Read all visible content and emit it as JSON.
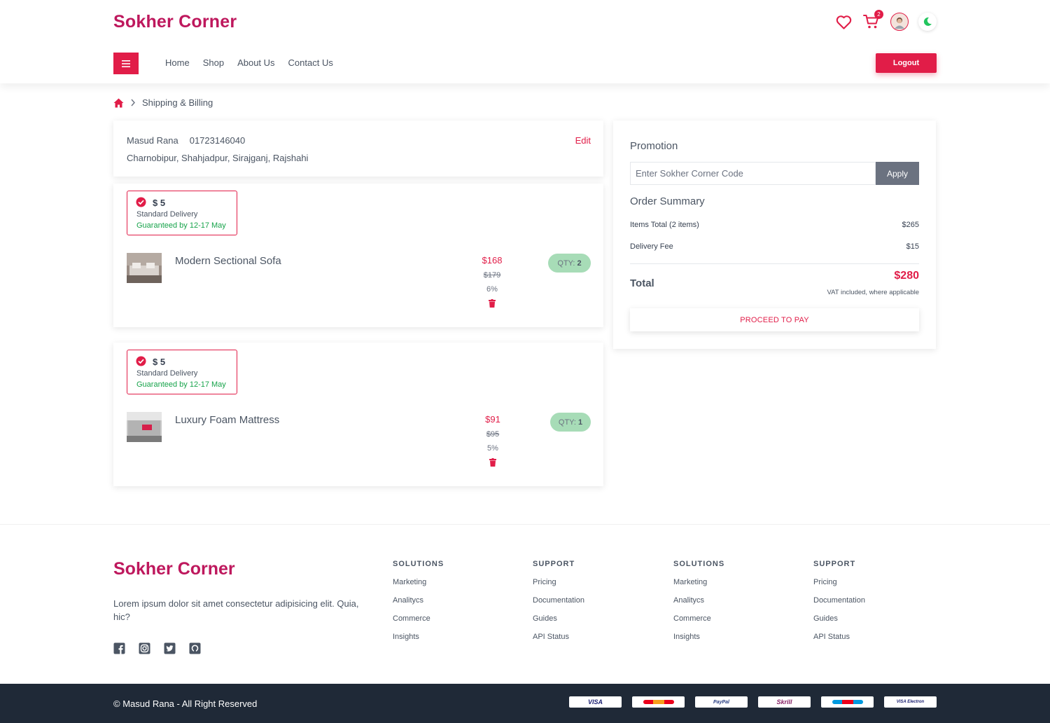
{
  "header": {
    "brand": "Sokher Corner",
    "cart_count": "2",
    "nav": [
      "Home",
      "Shop",
      "About Us",
      "Contact Us"
    ],
    "logout_label": "Logout"
  },
  "breadcrumb": {
    "current": "Shipping & Billing"
  },
  "address": {
    "name": "Masud Rana",
    "phone": "01723146040",
    "line": "Charnobipur, Shahjadpur, Sirajganj, Rajshahi",
    "edit_label": "Edit"
  },
  "items": [
    {
      "delivery_price": "$ 5",
      "delivery_type": "Standard Delivery",
      "delivery_guarantee": "Guaranteed by 12-17 May",
      "name": "Modern Sectional Sofa",
      "price": "$168",
      "old_price": "$179",
      "discount": "6%",
      "qty_label": "QTY:",
      "qty": "2"
    },
    {
      "delivery_price": "$ 5",
      "delivery_type": "Standard Delivery",
      "delivery_guarantee": "Guaranteed by 12-17 May",
      "name": "Luxury Foam Mattress",
      "price": "$91",
      "old_price": "$95",
      "discount": "5%",
      "qty_label": "QTY:",
      "qty": "1"
    }
  ],
  "summary": {
    "promotion_title": "Promotion",
    "promo_placeholder": "Enter Sokher Corner Code",
    "apply_label": "Apply",
    "order_summary_title": "Order Summary",
    "items_total_label": "Items Total (2 items)",
    "items_total_value": "$265",
    "delivery_fee_label": "Delivery Fee",
    "delivery_fee_value": "$15",
    "total_label": "Total",
    "total_value": "$280",
    "vat_note": "VAT included, where applicable",
    "pay_label": "PROCEED TO PAY"
  },
  "footer": {
    "brand": "Sokher Corner",
    "description": "Lorem ipsum dolor sit amet consectetur adipisicing elit. Quia, hic?",
    "columns": [
      {
        "title": "SOLUTIONS",
        "links": [
          "Marketing",
          "Analitycs",
          "Commerce",
          "Insights"
        ]
      },
      {
        "title": "SUPPORT",
        "links": [
          "Pricing",
          "Documentation",
          "Guides",
          "API Status"
        ]
      },
      {
        "title": "SOLUTIONS",
        "links": [
          "Marketing",
          "Analitycs",
          "Commerce",
          "Insights"
        ]
      },
      {
        "title": "SUPPORT",
        "links": [
          "Pricing",
          "Documentation",
          "Guides",
          "API Status"
        ]
      }
    ],
    "copyright": "© Masud Rana - All Right Reserved",
    "payment_methods": [
      "VISA",
      "Mastercard",
      "PayPal",
      "Skrill",
      "Maestro",
      "VISA Electron"
    ]
  },
  "colors": {
    "brand": "#be185d",
    "accent": "#e11d48",
    "success": "#16a34a",
    "qty_bg": "#a7dcb7",
    "footer_bg": "#1f2937"
  },
  "icons": [
    "heart-icon",
    "cart-icon",
    "avatar",
    "moon-icon",
    "menu-icon",
    "home-icon",
    "chevron-right-icon",
    "check-circle-icon",
    "trash-icon",
    "facebook-icon",
    "instagram-icon",
    "twitter-icon",
    "github-icon"
  ]
}
